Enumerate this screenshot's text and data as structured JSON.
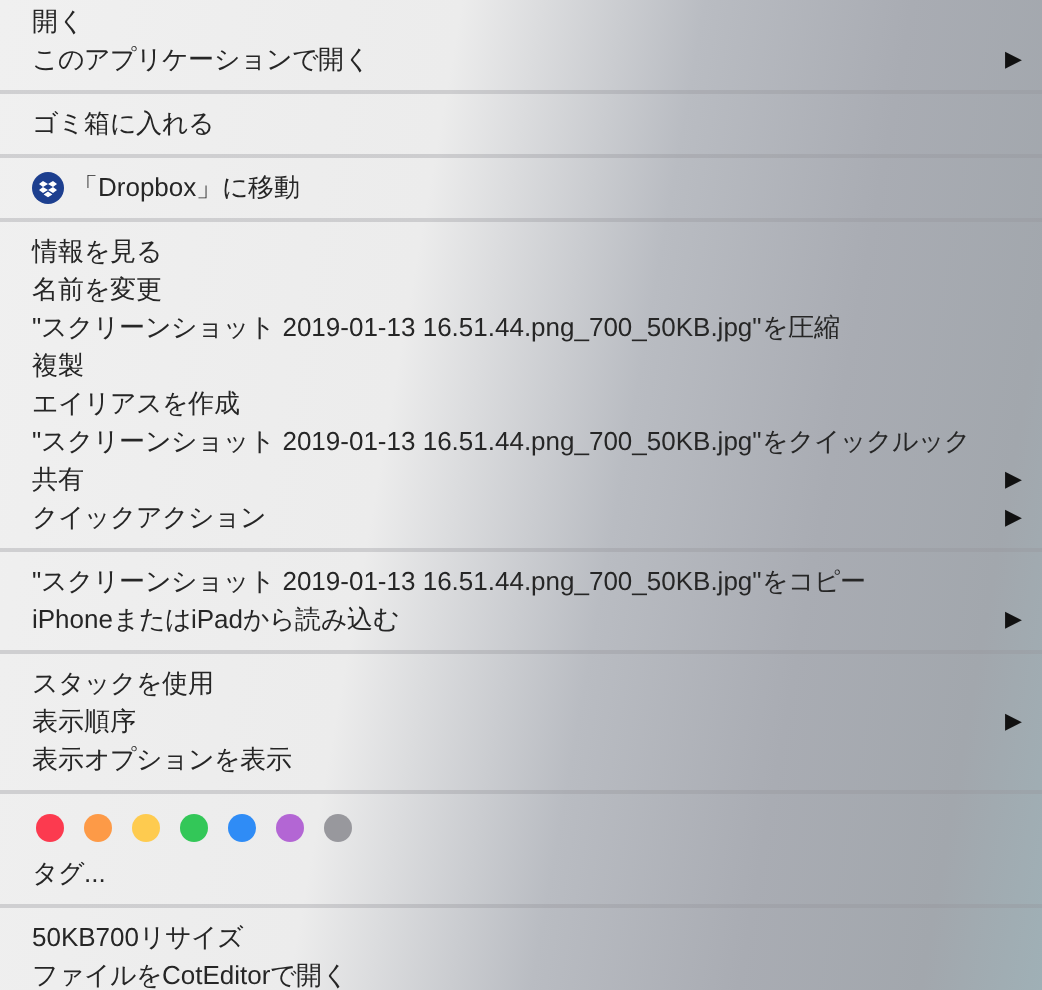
{
  "sections": [
    {
      "items": [
        {
          "kind": "item",
          "label": "開く",
          "submenu": false
        },
        {
          "kind": "item",
          "label": "このアプリケーションで開く",
          "submenu": true
        }
      ]
    },
    {
      "items": [
        {
          "kind": "item",
          "label": "ゴミ箱に入れる",
          "submenu": false
        }
      ]
    },
    {
      "items": [
        {
          "kind": "icon-item",
          "label": "「Dropbox」に移動",
          "submenu": false
        }
      ]
    },
    {
      "items": [
        {
          "kind": "item",
          "label": "情報を見る",
          "submenu": false
        },
        {
          "kind": "item",
          "label": "名前を変更",
          "submenu": false
        },
        {
          "kind": "item",
          "label": "\"スクリーンショット 2019-01-13 16.51.44.png_700_50KB.jpg\"を圧縮",
          "submenu": false
        },
        {
          "kind": "item",
          "label": "複製",
          "submenu": false
        },
        {
          "kind": "item",
          "label": "エイリアスを作成",
          "submenu": false
        },
        {
          "kind": "item",
          "label": "\"スクリーンショット 2019-01-13 16.51.44.png_700_50KB.jpg\"をクイックルック",
          "submenu": false
        },
        {
          "kind": "item",
          "label": "共有",
          "submenu": true
        },
        {
          "kind": "item",
          "label": "クイックアクション",
          "submenu": true
        }
      ]
    },
    {
      "items": [
        {
          "kind": "item",
          "label": "\"スクリーンショット 2019-01-13 16.51.44.png_700_50KB.jpg\"をコピー",
          "submenu": false
        },
        {
          "kind": "item",
          "label": "iPhoneまたはiPadから読み込む",
          "submenu": true
        }
      ]
    },
    {
      "items": [
        {
          "kind": "item",
          "label": "スタックを使用",
          "submenu": false
        },
        {
          "kind": "item",
          "label": "表示順序",
          "submenu": true
        },
        {
          "kind": "item",
          "label": "表示オプションを表示",
          "submenu": false
        }
      ]
    },
    {
      "items": [
        {
          "kind": "tags",
          "dots": [
            {
              "color": "#fc3a4f"
            },
            {
              "color": "#fd9a47"
            },
            {
              "color": "#fecb4f"
            },
            {
              "color": "#33c758"
            },
            {
              "color": "#2f8cf6"
            },
            {
              "color": "#b366d4"
            },
            {
              "color": "#98989d"
            }
          ]
        },
        {
          "kind": "item",
          "label": "タグ...",
          "submenu": false
        }
      ]
    },
    {
      "items": [
        {
          "kind": "item",
          "label": "50KB700リサイズ",
          "submenu": false
        },
        {
          "kind": "item",
          "label": "ファイルをCotEditorで開く",
          "submenu": false
        }
      ]
    }
  ],
  "submenu_arrow": "▶"
}
